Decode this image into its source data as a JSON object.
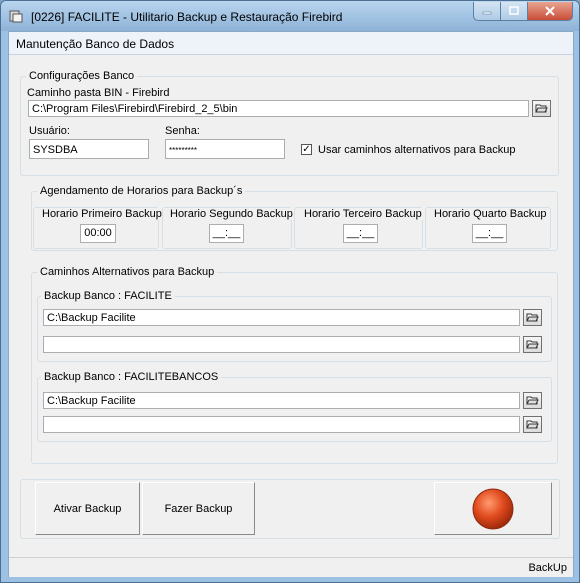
{
  "window": {
    "title": "[0226] FACILITE - Utilitario Backup e Restauração Firebird"
  },
  "header": {
    "title": "Manutenção Banco de Dados"
  },
  "config": {
    "legend": "Configurações Banco",
    "bin_label": "Caminho pasta BIN - Firebird",
    "bin_value": "C:\\Program Files\\Firebird\\Firebird_2_5\\bin",
    "user_label": "Usuário:",
    "user_value": "SYSDBA",
    "password_label": "Senha:",
    "password_value": "*********",
    "alt_paths_label": "Usar caminhos alternativos para Backup",
    "alt_paths_checked": "✓"
  },
  "schedule": {
    "legend": "Agendamento de Horarios para Backup´s",
    "first_label": "Horario Primeiro Backup",
    "first_value": "00:00",
    "second_label": "Horario Segundo Backup",
    "second_value": "__:__",
    "third_label": "Horario Terceiro Backup",
    "third_value": "__:__",
    "fourth_label": "Horario Quarto Backup",
    "fourth_value": "__:__"
  },
  "alt_paths": {
    "legend": "Caminhos Alternativos para Backup",
    "group1": {
      "legend": "Backup Banco : FACILITE",
      "path1": "C:\\Backup Facilite",
      "path2": ""
    },
    "group2": {
      "legend": "Backup Banco : FACILITEBANCOS",
      "path1": "C:\\Backup Facilite",
      "path2": ""
    }
  },
  "buttons": {
    "activate": "Ativar Backup",
    "run": "Fazer Backup"
  },
  "status": {
    "text": "BackUp"
  },
  "icons": {
    "browse": "folder-open-icon",
    "status_light": "red-status-indicator"
  },
  "colors": {
    "status_light": "#e04a1e",
    "title_bar": "#9cc1e3",
    "close_button": "#c94c36"
  }
}
